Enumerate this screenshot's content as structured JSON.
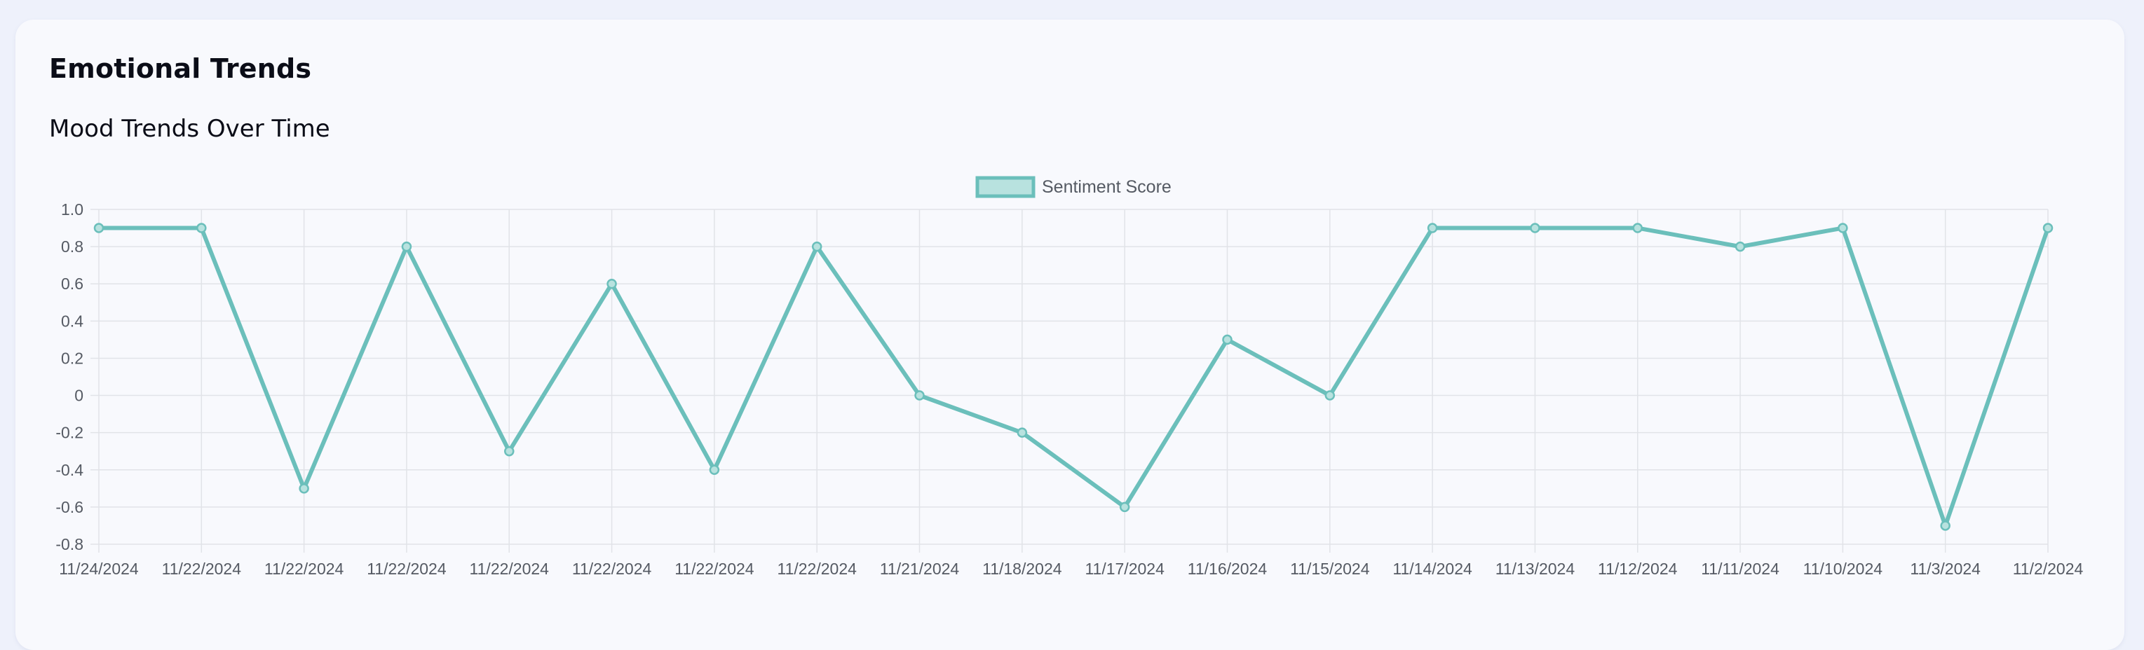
{
  "card": {
    "title": "Emotional Trends"
  },
  "chart_data": {
    "type": "line",
    "title": "Mood Trends Over Time",
    "xlabel": "",
    "ylabel": "",
    "categories": [
      "11/24/2024",
      "11/22/2024",
      "11/22/2024",
      "11/22/2024",
      "11/22/2024",
      "11/22/2024",
      "11/22/2024",
      "11/22/2024",
      "11/21/2024",
      "11/18/2024",
      "11/17/2024",
      "11/16/2024",
      "11/15/2024",
      "11/14/2024",
      "11/13/2024",
      "11/12/2024",
      "11/11/2024",
      "11/10/2024",
      "11/3/2024",
      "11/2/2024"
    ],
    "series": [
      {
        "name": "Sentiment Score",
        "values": [
          0.9,
          0.9,
          -0.5,
          0.8,
          -0.3,
          0.6,
          -0.4,
          0.8,
          0.0,
          -0.2,
          -0.6,
          0.3,
          0.0,
          0.9,
          0.9,
          0.9,
          0.8,
          0.9,
          -0.7,
          0.9
        ]
      }
    ],
    "ylim": [
      -0.8,
      1.0
    ],
    "yticks": [
      "1.0",
      "0.8",
      "0.6",
      "0.4",
      "0.2",
      "0",
      "-0.2",
      "-0.4",
      "-0.6",
      "-0.8"
    ],
    "grid": true,
    "legend": "top-center",
    "colors": {
      "line": "#6bbfbb",
      "fill": "#b8e2df",
      "grid": "#e1e3e8",
      "axis_text": "#555a63"
    }
  }
}
